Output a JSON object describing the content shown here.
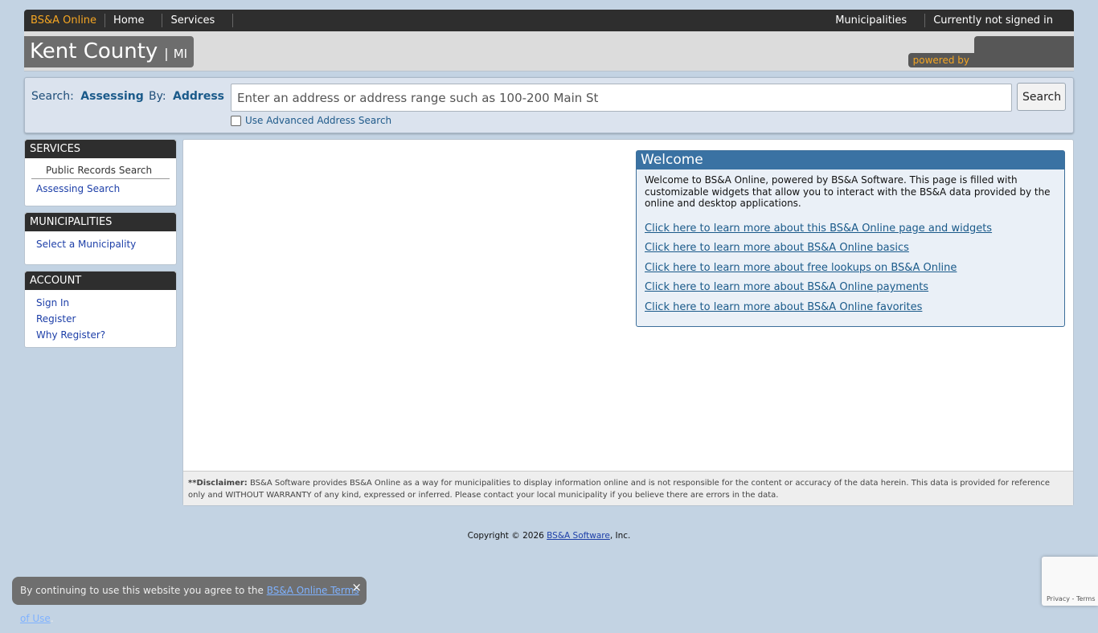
{
  "topbar": {
    "brand": "BS&A Online",
    "home": "Home",
    "services": "Services",
    "municipalities": "Municipalities",
    "signin_status": "Currently not signed in"
  },
  "header": {
    "county": "Kent County",
    "pipe": "|",
    "state": "MI",
    "powered_by": "powered by"
  },
  "search": {
    "search_label": "Search:",
    "search_value": "Assessing",
    "by_label": "By:",
    "by_value": "Address",
    "placeholder": "Enter an address or address range such as 100-200 Main St",
    "button": "Search",
    "advanced": "Use Advanced Address Search"
  },
  "sidebar": {
    "services": {
      "title": "SERVICES",
      "sub": "Public Records Search",
      "links": [
        "Assessing Search"
      ]
    },
    "municipalities": {
      "title": "MUNICIPALITIES",
      "links": [
        "Select a Municipality"
      ]
    },
    "account": {
      "title": "ACCOUNT",
      "links": [
        "Sign In",
        "Register",
        "Why Register?"
      ]
    }
  },
  "welcome": {
    "title": "Welcome",
    "text": "Welcome to BS&A Online, powered by BS&A Software. This page is filled with customizable widgets that allow you to interact with the BS&A data provided by the online and desktop applications.",
    "links": [
      "Click here to learn more about this BS&A Online page and widgets",
      "Click here to learn more about BS&A Online basics",
      "Click here to learn more about free lookups on BS&A Online",
      "Click here to learn more about BS&A Online payments",
      "Click here to learn more about BS&A Online favorites"
    ]
  },
  "disclaimer": {
    "label": "**Disclaimer:",
    "text": " BS&A Software provides BS&A Online as a way for municipalities to display information online and is not responsible for the content or accuracy of the data herein. This data is provided for reference only and WITHOUT WARRANTY of any kind, expressed or inferred. Please contact your local municipality if you believe there are errors in the data."
  },
  "footer": {
    "copyright_prefix": "Copyright © 2026 ",
    "copyright_link": "BS&A Software",
    "copyright_suffix": ", Inc."
  },
  "toast": {
    "text": "By continuing to use this website you agree to the ",
    "link": "BS&A Online Terms of Use",
    "end": ".",
    "close": "×"
  },
  "recaptcha": {
    "privacy": "Privacy",
    "sep": " - ",
    "terms": "Terms"
  }
}
